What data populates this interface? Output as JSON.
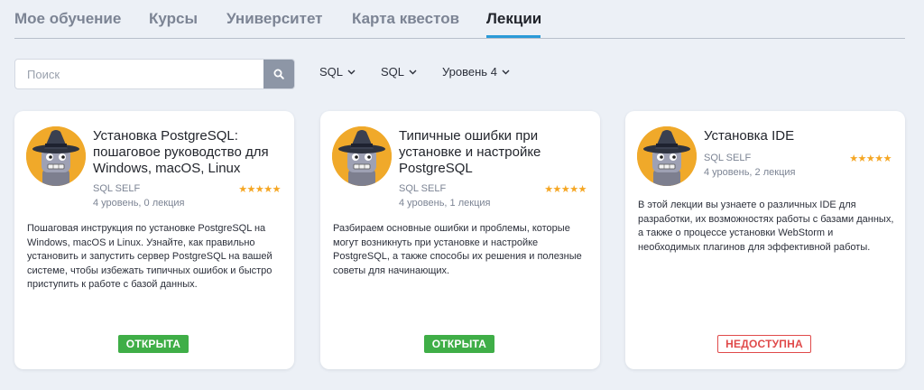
{
  "tabs": [
    {
      "label": "Мое обучение",
      "active": false
    },
    {
      "label": "Курсы",
      "active": false
    },
    {
      "label": "Университет",
      "active": false
    },
    {
      "label": "Карта квестов",
      "active": false
    },
    {
      "label": "Лекции",
      "active": true
    }
  ],
  "search": {
    "placeholder": "Поиск",
    "value": "",
    "icon": "search-icon"
  },
  "filters": [
    {
      "label": "SQL"
    },
    {
      "label": "SQL"
    },
    {
      "label": "Уровень 4"
    }
  ],
  "colors": {
    "accent": "#2a9ad8",
    "open": "#3fae47",
    "closed": "#e04a4a",
    "stars": "#f5a623",
    "background": "#ecf0f6"
  },
  "cards": [
    {
      "title": "Установка PostgreSQL: пошаговое руководство для Windows, macOS, Linux",
      "course": "SQL SELF",
      "meta": "4 уровень, 0 лекция",
      "rating": 5,
      "stars": "★★★★★",
      "description": "Пошаговая инструкция по установке PostgreSQL на Windows, macOS и Linux. Узнайте, как правильно установить и запустить сервер PostgreSQL на вашей системе, чтобы избежать типичных ошибок и быстро приступить к работе с базой данных.",
      "status": "ОТКРЫТА",
      "status_type": "open"
    },
    {
      "title": "Типичные ошибки при установке и настройке PostgreSQL",
      "course": "SQL SELF",
      "meta": "4 уровень, 1 лекция",
      "rating": 5,
      "stars": "★★★★★",
      "description": "Разбираем основные ошибки и проблемы, которые могут возникнуть при установке и настройке PostgreSQL, а также способы их решения и полезные советы для начинающих.",
      "status": "ОТКРЫТА",
      "status_type": "open"
    },
    {
      "title": "Установка IDE",
      "course": "SQL SELF",
      "meta": "4 уровень, 2 лекция",
      "rating": 5,
      "stars": "★★★★★",
      "description": "В этой лекции вы узнаете о различных IDE для разработки, их возможностях работы с базами данных, а также о процессе установки WebStorm и необходимых плагинов для эффективной работы.",
      "status": "НЕДОСТУПНА",
      "status_type": "closed"
    }
  ]
}
